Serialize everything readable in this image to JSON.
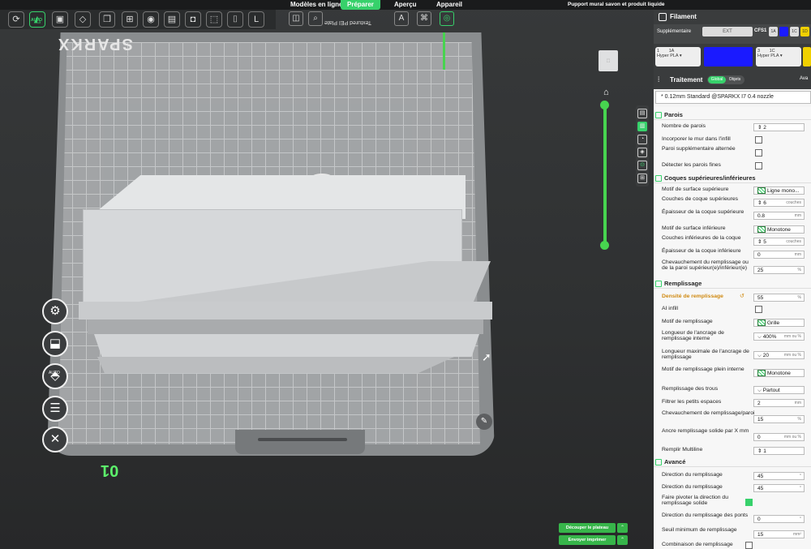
{
  "topbar": {
    "tabs": [
      "Modèles en ligne",
      "Préparer",
      "Aperçu",
      "Appareil"
    ],
    "project_title": "Pupport mural savon et produit liquide"
  },
  "toolbar": {
    "auto_label": "AUTO"
  },
  "bed": {
    "logo": "SPARKX",
    "label": "Textured PEI Plate",
    "plate_number": "01"
  },
  "left_tools": {
    "auto_label": "AUTO"
  },
  "actions": {
    "slice_label": "Découper le plateau",
    "send_label": "Envoyer imprimer"
  },
  "panel": {
    "filament_title": "Filament",
    "supplementaire": "Supplémentaire",
    "ext": "EXT",
    "cfs": "CFS1",
    "chips": [
      "1A",
      "1C",
      "1D"
    ],
    "filaments": [
      {
        "num": "1",
        "slot": "1A",
        "name": "Hyper PLA",
        "color": "#1a1aff"
      },
      {
        "num": "3",
        "slot": "1C",
        "name": "Hyper PLA",
        "color": "#f0d000"
      }
    ],
    "process_title": "Traitement",
    "toggle_on": "Global",
    "toggle_off": "Objets",
    "avance": "Ava",
    "preset": "* 0.12mm Standard @SPARKX I7 0.4 nozzle"
  },
  "settings": {
    "sec_parois": "Parois",
    "nb_parois_label": "Nombre de parois",
    "nb_parois_val": "2",
    "incorporer_label": "Incorporer le mur dans l'infill",
    "paroi_alt_label": "Paroi supplémentaire alternée",
    "detect_label": "Détecter les parois fines",
    "sec_coques": "Coques supérieures/inférieures",
    "motif_sup_label": "Motif de surface supérieure",
    "motif_sup_val": "Ligne mono...",
    "couches_sup_label": "Couches de coque supérieures",
    "couches_sup_val": "6",
    "couches_unit": "couches",
    "epais_sup_label": "Épaisseur de la coque supérieure",
    "epais_sup_val": "0.8",
    "mm": "mm",
    "motif_inf_label": "Motif de surface inférieure",
    "motif_inf_val": "Monotone",
    "couches_inf_label": "Couches inférieures de la coque",
    "couches_inf_val": "5",
    "epais_inf_label": "Épaisseur de la coque inférieure",
    "epais_inf_val": "0",
    "chevau_label": "Chevauchement du remplissage ou de la paroi supérieur(e)/inférieur(e)",
    "chevau_val": "25",
    "pct": "%",
    "sec_remplissage": "Remplissage",
    "densite_label": "Densité de remplissage",
    "densite_val": "55",
    "ai_infill_label": "AI infill",
    "motif_rem_label": "Motif de remplissage",
    "motif_rem_val": "Grille",
    "long_ancr_label": "Longueur de l'ancrage de remplissage interne",
    "long_ancr_val": "400%",
    "mm_ou_pct": "mm ou %",
    "long_max_label": "Longueur maximale de l'ancrage de remplissage",
    "long_max_val": "20",
    "motif_plein_label": "Motif de remplissage plein interne",
    "motif_plein_val": "Monotone",
    "trous_label": "Remplissage des trous",
    "trous_val": "Partout",
    "filtrer_label": "Filtrer les petits espaces",
    "filtrer_val": "2",
    "chev_paroi_label": "Chevauchement de remplissage/paroi",
    "chev_paroi_val": "15",
    "ancre_label": "Ancre remplissage solide par X mm",
    "ancre_val": "0",
    "multiline_label": "Remplir Multiline",
    "multiline_val": "1",
    "sec_avance": "Avancé",
    "dir1_label": "Direction du remplissage",
    "dir1_val": "45",
    "deg": "°",
    "dir2_label": "Direction du remplissage",
    "dir2_val": "45",
    "pivot_label": "Faire pivoter la direction du remplissage solide",
    "dir_ponts_label": "Direction du remplissage des ponts",
    "dir_ponts_val": "0",
    "seuil_label": "Seuil minimum de remplissage",
    "seuil_val": "15",
    "mm2": "mm²",
    "combi_label": "Combinaison de remplissage"
  },
  "colors": {
    "accent": "#37d16b",
    "axis": "#47d44f",
    "plate_number": "#5cf06b",
    "highlight": "#d08a12"
  }
}
